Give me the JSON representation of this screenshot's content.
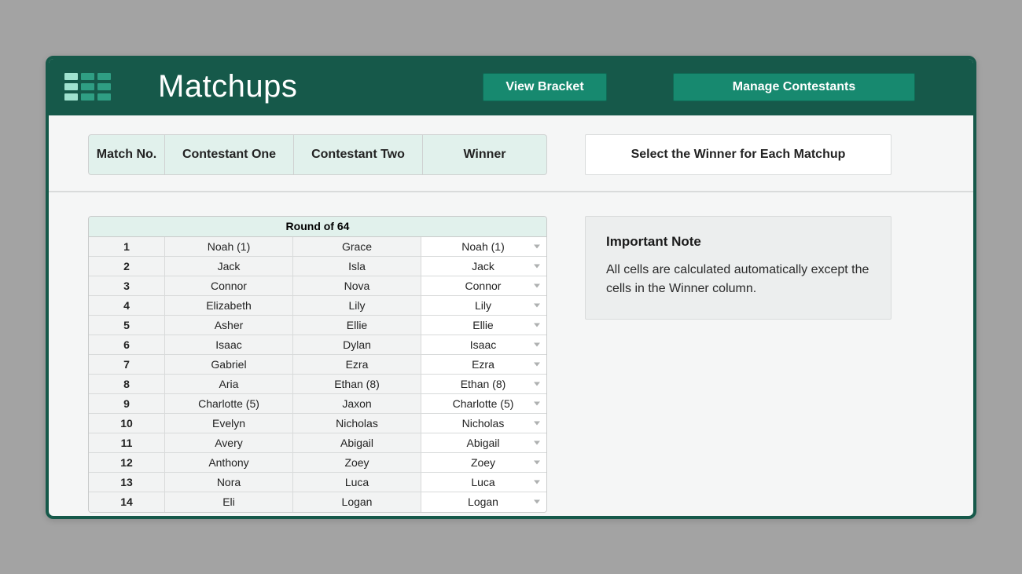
{
  "header": {
    "title": "Matchups",
    "view_bracket": "View Bracket",
    "manage_contestants": "Manage Contestants"
  },
  "columns": {
    "match_no": "Match No.",
    "contestant_one": "Contestant One",
    "contestant_two": "Contestant Two",
    "winner": "Winner"
  },
  "instruction": "Select the Winner for Each Matchup",
  "round_title": "Round of 64",
  "note": {
    "title": "Important Note",
    "body": "All cells are calculated automatically except the cells in the Winner column."
  },
  "rows": [
    {
      "no": "1",
      "p1": "Noah  (1)",
      "p2": "Grace",
      "win": "Noah  (1)"
    },
    {
      "no": "2",
      "p1": "Jack",
      "p2": "Isla",
      "win": "Jack"
    },
    {
      "no": "3",
      "p1": "Connor",
      "p2": "Nova",
      "win": "Connor"
    },
    {
      "no": "4",
      "p1": "Elizabeth",
      "p2": "Lily",
      "win": "Lily"
    },
    {
      "no": "5",
      "p1": "Asher",
      "p2": "Ellie",
      "win": "Ellie"
    },
    {
      "no": "6",
      "p1": "Isaac",
      "p2": "Dylan",
      "win": "Isaac"
    },
    {
      "no": "7",
      "p1": "Gabriel",
      "p2": "Ezra",
      "win": "Ezra"
    },
    {
      "no": "8",
      "p1": "Aria",
      "p2": "Ethan  (8)",
      "win": "Ethan  (8)"
    },
    {
      "no": "9",
      "p1": "Charlotte  (5)",
      "p2": "Jaxon",
      "win": "Charlotte  (5)"
    },
    {
      "no": "10",
      "p1": "Evelyn",
      "p2": "Nicholas",
      "win": "Nicholas"
    },
    {
      "no": "11",
      "p1": "Avery",
      "p2": "Abigail",
      "win": "Abigail"
    },
    {
      "no": "12",
      "p1": "Anthony",
      "p2": "Zoey",
      "win": "Zoey"
    },
    {
      "no": "13",
      "p1": "Nora",
      "p2": "Luca",
      "win": "Luca"
    },
    {
      "no": "14",
      "p1": "Eli",
      "p2": "Logan",
      "win": "Logan"
    }
  ]
}
